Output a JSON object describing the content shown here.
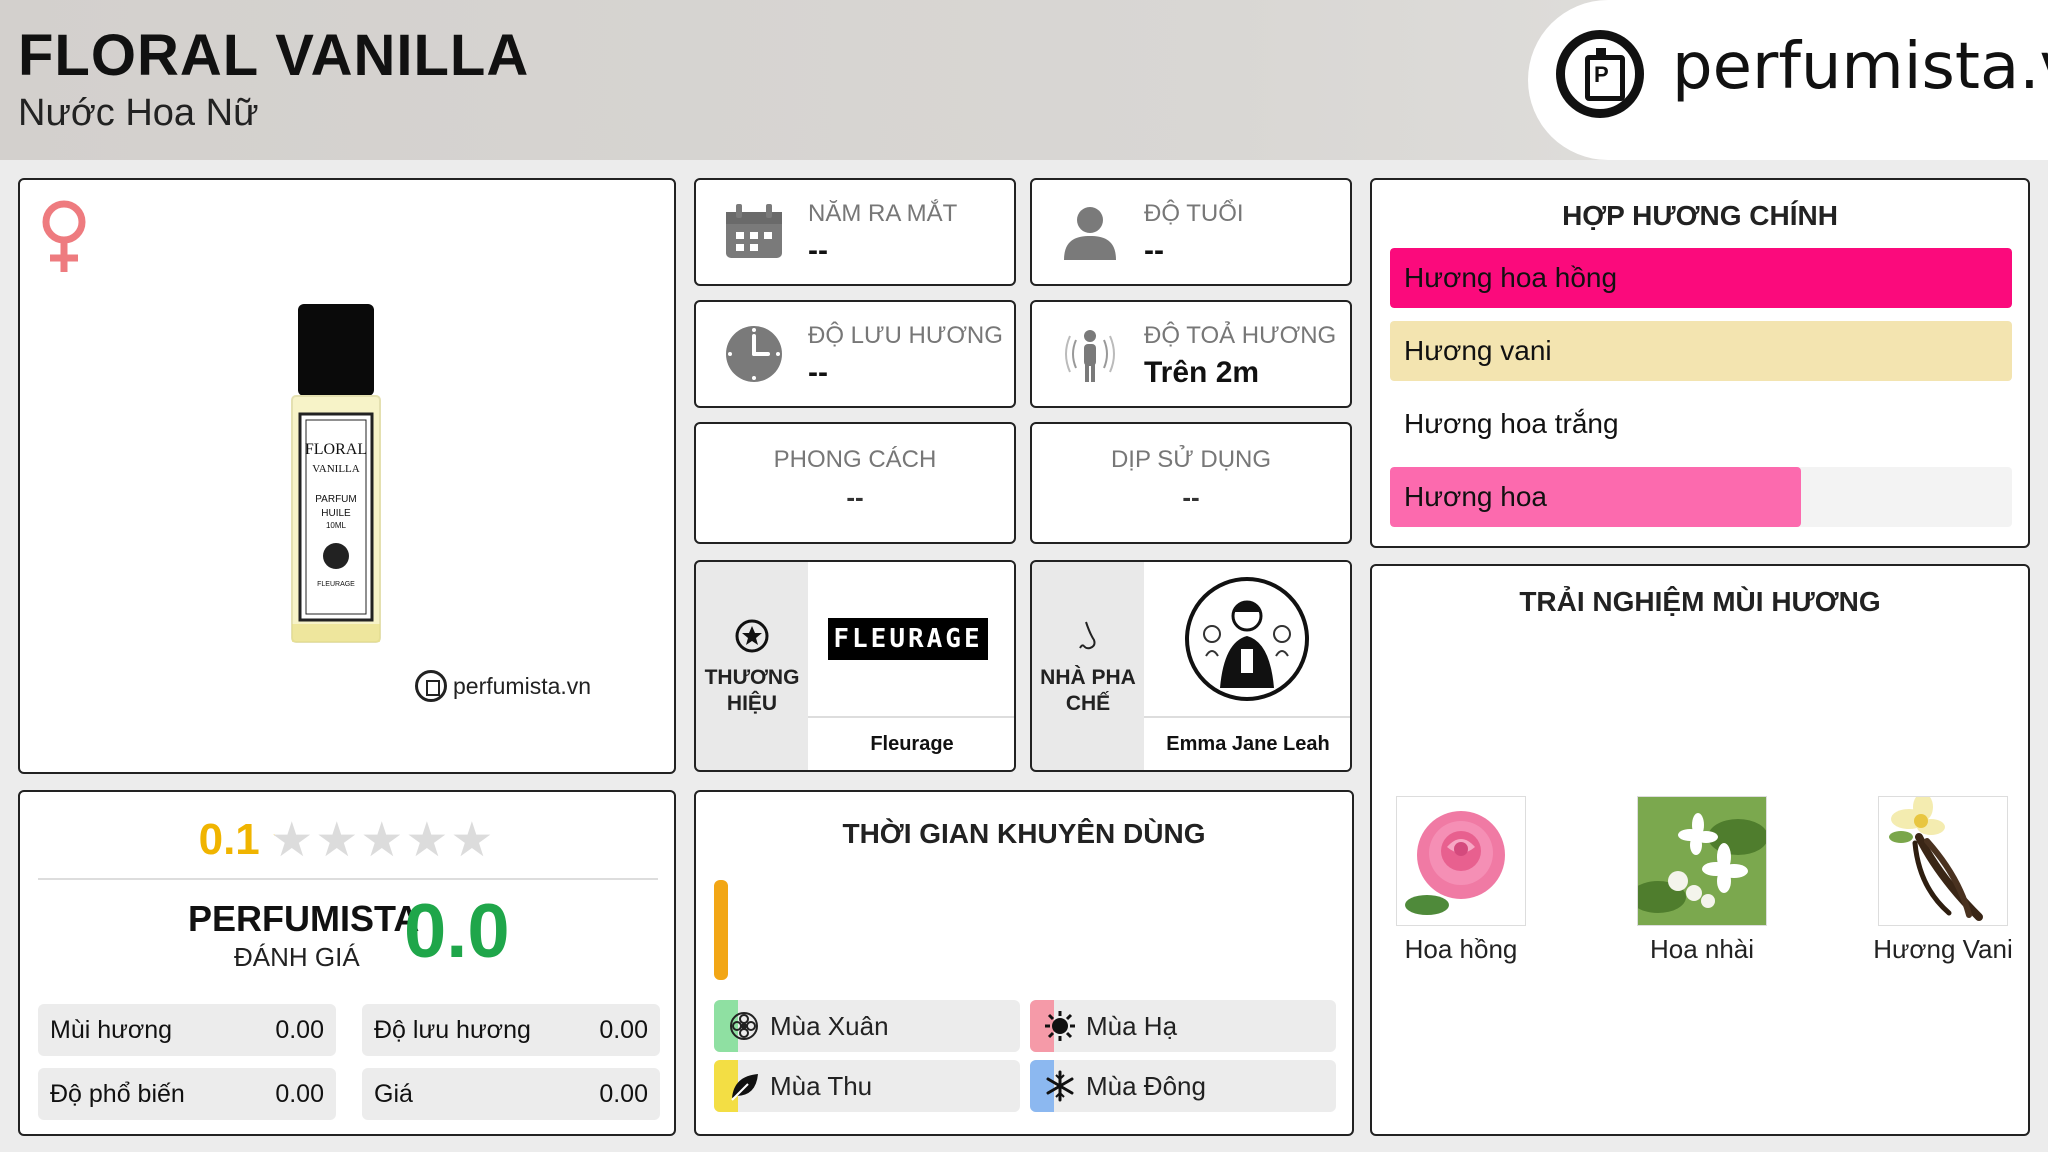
{
  "header": {
    "title": "FLORAL VANILLA",
    "subtitle": "Nước Hoa Nữ",
    "logo_text": "perfumista.vn"
  },
  "product": {
    "watermark": "perfumista.vn",
    "bottle_label": [
      "FLORAL",
      "VANILLA",
      "PARFUM",
      "HUILE",
      "10ML",
      "FLEURAGE"
    ]
  },
  "info": {
    "launch_year": {
      "label": "NĂM RA MẮT",
      "value": "--"
    },
    "age": {
      "label": "ĐỘ TUỔI",
      "value": "--"
    },
    "longevity": {
      "label": "ĐỘ LƯU HƯƠNG",
      "value": "--"
    },
    "sillage": {
      "label": "ĐỘ TOẢ HƯƠNG",
      "value": "Trên 2m"
    },
    "style": {
      "label": "PHONG CÁCH",
      "value": "--"
    },
    "occasion": {
      "label": "DỊP SỬ DỤNG",
      "value": "--"
    },
    "brand": {
      "label_line1": "THƯƠNG",
      "label_line2": "HIỆU",
      "logo_text": "FLEURAGE",
      "name": "Fleurage"
    },
    "perfumer": {
      "label_line1": "NHÀ PHA",
      "label_line2": "CHẾ",
      "name": "Emma Jane Leah"
    }
  },
  "notes": {
    "title": "HỢP HƯƠNG CHÍNH",
    "items": [
      {
        "label": "Hương hoa hồng",
        "fill": 1.0,
        "color": "#fb0a7c"
      },
      {
        "label": "Hương vani",
        "fill": 1.0,
        "color": "#f3e4b0"
      },
      {
        "label": "Hương hoa trắng",
        "fill": 1.0,
        "color": "#ffffff"
      },
      {
        "label": "Hương hoa",
        "fill": 0.66,
        "color": "#fc6aae"
      }
    ]
  },
  "experience": {
    "title": "TRẢI NGHIỆM MÙI HƯƠNG",
    "items": [
      {
        "label": "Hoa hồng",
        "icon": "rose-image"
      },
      {
        "label": "Hoa nhài",
        "icon": "jasmine-image"
      },
      {
        "label": "Hương Vani",
        "icon": "vanilla-image"
      }
    ]
  },
  "rating": {
    "user_score": "0.1",
    "stars_filled": 0.1,
    "stars_total": 5,
    "pf_title": "PERFUMISTA",
    "pf_sub": "ĐÁNH GIÁ",
    "pf_score": "0.0",
    "metrics": [
      {
        "label": "Mùi hương",
        "value": "0.00"
      },
      {
        "label": "Độ lưu hương",
        "value": "0.00"
      },
      {
        "label": "Độ phổ biến",
        "value": "0.00"
      },
      {
        "label": "Giá",
        "value": "0.00"
      }
    ]
  },
  "seasons": {
    "title": "THỜI GIAN KHUYÊN DÙNG",
    "items": [
      {
        "label": "Mùa Xuân",
        "color": "#8fe0a2"
      },
      {
        "label": "Mùa Hạ",
        "color": "#f59aa8"
      },
      {
        "label": "Mùa Thu",
        "color": "#f3de44"
      },
      {
        "label": "Mùa Đông",
        "color": "#8cb8f0"
      }
    ],
    "bar_color": "#f2a615"
  }
}
